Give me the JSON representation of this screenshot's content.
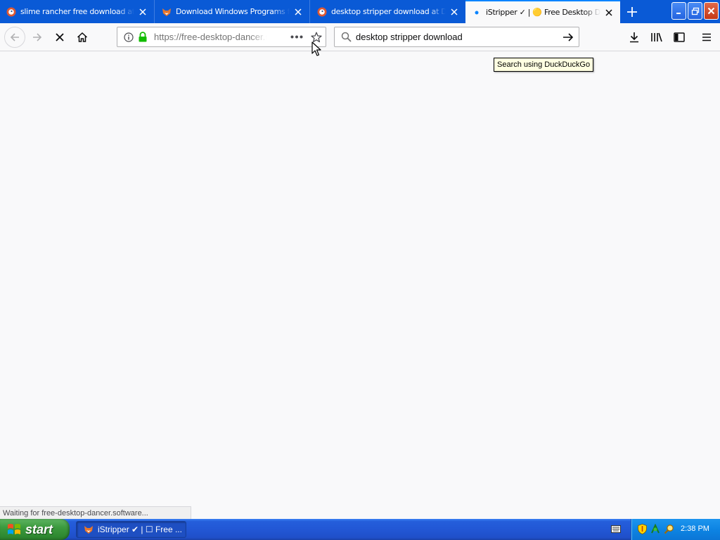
{
  "browser": {
    "tabs": [
      {
        "title": "slime rancher free download at DuckDuckGo",
        "favicon": "duckduckgo-icon",
        "active": false
      },
      {
        "title": "Download Windows Programs for Free",
        "favicon": "fox-icon",
        "active": false
      },
      {
        "title": "desktop stripper download at DuckDuckGo",
        "favicon": "duckduckgo-icon",
        "active": false
      },
      {
        "title": "iStripper ✓ | 🟡 Free Desktop Dancer",
        "favicon": "loading-dot-icon",
        "active": true
      }
    ],
    "url": "https://free-desktop-dancer.software",
    "search_query": "desktop stripper download",
    "search_tooltip": "Search using DuckDuckGo",
    "status": "Waiting for free-desktop-dancer.software..."
  },
  "taskbar": {
    "start_label": "start",
    "task_label": "iStripper ✔ | ☐ Free ...",
    "clock": "2:38 PM"
  },
  "colors": {
    "tabstrip": "#0a5ad6",
    "active_tab": "#f9f9fa",
    "accent": "#0a84ff",
    "start_green": "#3c9a3e",
    "taskbar_blue": "#245edb"
  }
}
